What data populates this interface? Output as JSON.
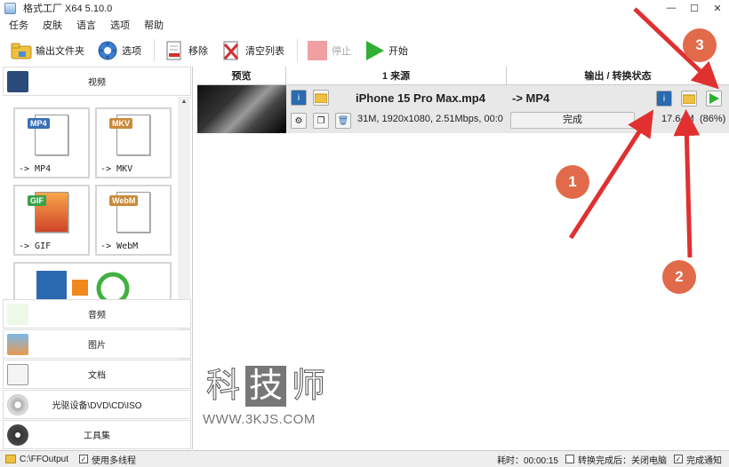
{
  "window": {
    "title": "格式工厂 X64 5.10.0",
    "min": "—",
    "max": "☐",
    "close": "✕"
  },
  "menu": [
    "任务",
    "皮肤",
    "语言",
    "选项",
    "帮助"
  ],
  "toolbar": {
    "output_folder": "输出文件夹",
    "options": "选项",
    "remove": "移除",
    "clear_list": "清空列表",
    "stop": "停止",
    "start": "开始"
  },
  "left": {
    "video": "视频",
    "tiles": [
      {
        "badge": "MP4",
        "label": "-> MP4",
        "color": "#3a6fb5"
      },
      {
        "badge": "MKV",
        "label": "-> MKV",
        "color": "#c98a3a"
      },
      {
        "badge": "GIF",
        "label": "-> GIF",
        "color": "#3aa24a"
      },
      {
        "badge": "WebM",
        "label": "-> WebM",
        "color": "#c98a3a"
      }
    ],
    "audio": "音频",
    "image": "图片",
    "document": "文档",
    "optical": "光驱设备\\DVD\\CD\\ISO",
    "tools": "工具集"
  },
  "right": {
    "col_preview": "预览",
    "col_source": "1 来源",
    "col_output": "输出 / 转换状态",
    "task": {
      "filename": "iPhone 15 Pro Max.mp4",
      "output_format": "-> MP4",
      "meta": "31M, 1920x1080, 2.51Mbps, 00:0",
      "status": "完成",
      "size": "17.64M",
      "percent": "(86%)"
    }
  },
  "watermark": {
    "chars": [
      "科",
      "技",
      "师"
    ],
    "url": "WWW.3KJS.COM"
  },
  "annotations": [
    "1",
    "2",
    "3"
  ],
  "status": {
    "output_path": "C:\\FFOutput",
    "multithread": "使用多线程",
    "elapsed": "耗时：00:00:15",
    "after_done": "转换完成后：关闭电脑",
    "notify": "完成通知"
  },
  "colors": {
    "accent": "#e03030",
    "annotation_circle": "#e06a4a"
  }
}
